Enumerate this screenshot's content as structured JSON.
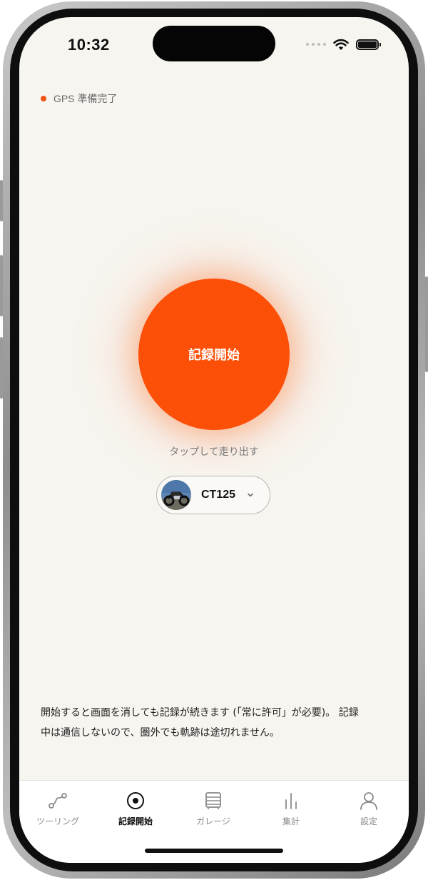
{
  "status_bar": {
    "time": "10:32"
  },
  "gps": {
    "label": "GPS 準備完了",
    "dot_color": "#f05313"
  },
  "record": {
    "button_label": "記録開始",
    "hint": "タップして走り出す",
    "accent_color": "#fc4f08"
  },
  "bike_selector": {
    "selected": "CT125",
    "icon": "chevron-down-icon"
  },
  "notice": {
    "line1": "開始すると画面を消しても記録が続きます (「常に許可」が必要)。 記録",
    "line2": "中は通信しないので、圏外でも軌跡は途切れません。"
  },
  "tabs": [
    {
      "label": "ツーリング",
      "icon": "route-icon",
      "active": false
    },
    {
      "label": "記録開始",
      "icon": "record-target-icon",
      "active": true
    },
    {
      "label": "ガレージ",
      "icon": "garage-icon",
      "active": false
    },
    {
      "label": "集計",
      "icon": "stats-bars-icon",
      "active": false
    },
    {
      "label": "設定",
      "icon": "person-icon",
      "active": false
    }
  ]
}
